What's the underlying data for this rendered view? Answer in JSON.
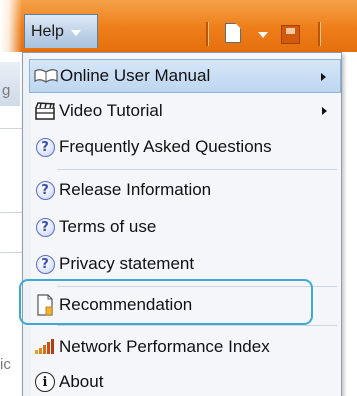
{
  "toolbar": {
    "help_label": "Help"
  },
  "background": {
    "left_char_1": "g",
    "left_char_2": "ic"
  },
  "menu": {
    "items": [
      {
        "label": "Online User Manual",
        "icon": "book-icon",
        "has_submenu": true
      },
      {
        "label": "Video Tutorial",
        "icon": "film-icon",
        "has_submenu": true
      },
      {
        "label": "Frequently Asked Questions",
        "icon": "question-icon",
        "has_submenu": false
      },
      {
        "label": "Release Information",
        "icon": "question-icon",
        "has_submenu": false
      },
      {
        "label": "Terms of use",
        "icon": "question-icon",
        "has_submenu": false
      },
      {
        "label": "Privacy statement",
        "icon": "question-icon",
        "has_submenu": false
      },
      {
        "label": "Recommendation",
        "icon": "document-icon",
        "has_submenu": false
      },
      {
        "label": "Network Performance Index",
        "icon": "signal-bars-icon",
        "has_submenu": false
      },
      {
        "label": "About",
        "icon": "info-icon",
        "has_submenu": false
      }
    ],
    "highlighted_index": 0,
    "question_glyph": "?",
    "info_glyph": "i"
  },
  "colors": {
    "toolbar_orange": "#ee7d18",
    "highlight_blue": "#bcd6f1",
    "focus_ring": "#3fa9d6"
  }
}
